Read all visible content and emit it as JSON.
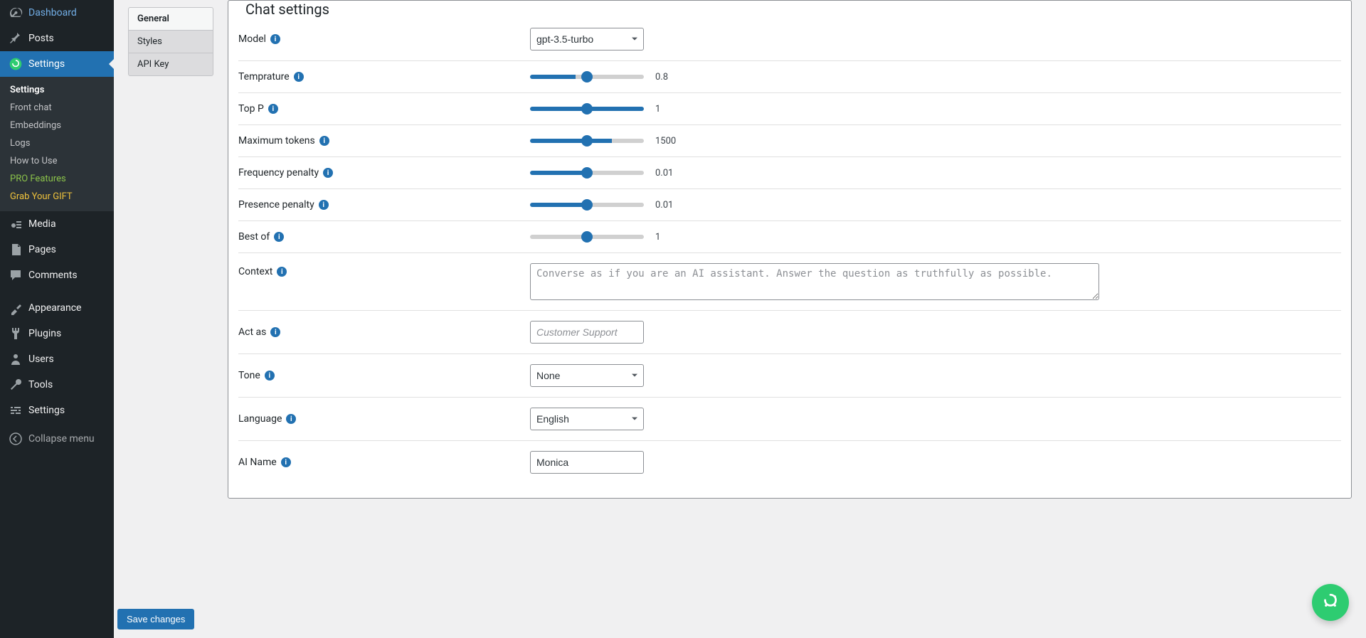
{
  "sidebar": {
    "items": [
      {
        "id": "dashboard",
        "label": "Dashboard",
        "icon": "gauge"
      },
      {
        "id": "posts",
        "label": "Posts",
        "icon": "pin"
      },
      {
        "id": "settings-plugin",
        "label": "Settings",
        "icon": "plugin-logo",
        "active": true
      },
      {
        "id": "media",
        "label": "Media",
        "icon": "media"
      },
      {
        "id": "pages",
        "label": "Pages",
        "icon": "pages"
      },
      {
        "id": "comments",
        "label": "Comments",
        "icon": "comments"
      },
      {
        "id": "appearance",
        "label": "Appearance",
        "icon": "brush"
      },
      {
        "id": "plugins",
        "label": "Plugins",
        "icon": "plug"
      },
      {
        "id": "users",
        "label": "Users",
        "icon": "user"
      },
      {
        "id": "tools",
        "label": "Tools",
        "icon": "wrench"
      },
      {
        "id": "wp-settings",
        "label": "Settings",
        "icon": "sliders"
      }
    ],
    "submenu": [
      {
        "label": "Settings",
        "current": true
      },
      {
        "label": "Front chat"
      },
      {
        "label": "Embeddings"
      },
      {
        "label": "Logs"
      },
      {
        "label": "How to Use"
      },
      {
        "label": "PRO Features",
        "class": "green"
      },
      {
        "label": "Grab Your GIFT",
        "class": "yellow"
      }
    ],
    "collapse_label": "Collapse menu"
  },
  "tabs": [
    {
      "label": "General",
      "active": true
    },
    {
      "label": "Styles"
    },
    {
      "label": "API Key"
    }
  ],
  "panel": {
    "legend": "Chat settings",
    "model": {
      "label": "Model",
      "value": "gpt-3.5-turbo"
    },
    "temperature": {
      "label": "Temprature",
      "value": "0.8",
      "fill": "40%"
    },
    "top_p": {
      "label": "Top P",
      "value": "1",
      "fill": "100%"
    },
    "max_tokens": {
      "label": "Maximum tokens",
      "value": "1500",
      "fill": "72%"
    },
    "freq_penalty": {
      "label": "Frequency penalty",
      "value": "0.01",
      "fill": "50%"
    },
    "pres_penalty": {
      "label": "Presence penalty",
      "value": "0.01",
      "fill": "50%"
    },
    "best_of": {
      "label": "Best of",
      "value": "1",
      "fill": "0%"
    },
    "context": {
      "label": "Context",
      "placeholder": "Converse as if you are an AI assistant. Answer the question as truthfully as possible."
    },
    "act_as": {
      "label": "Act as",
      "placeholder": "Customer Support"
    },
    "tone": {
      "label": "Tone",
      "value": "None"
    },
    "language": {
      "label": "Language",
      "value": "English"
    },
    "ai_name": {
      "label": "AI Name",
      "value": "Monica"
    }
  },
  "save_label": "Save changes"
}
